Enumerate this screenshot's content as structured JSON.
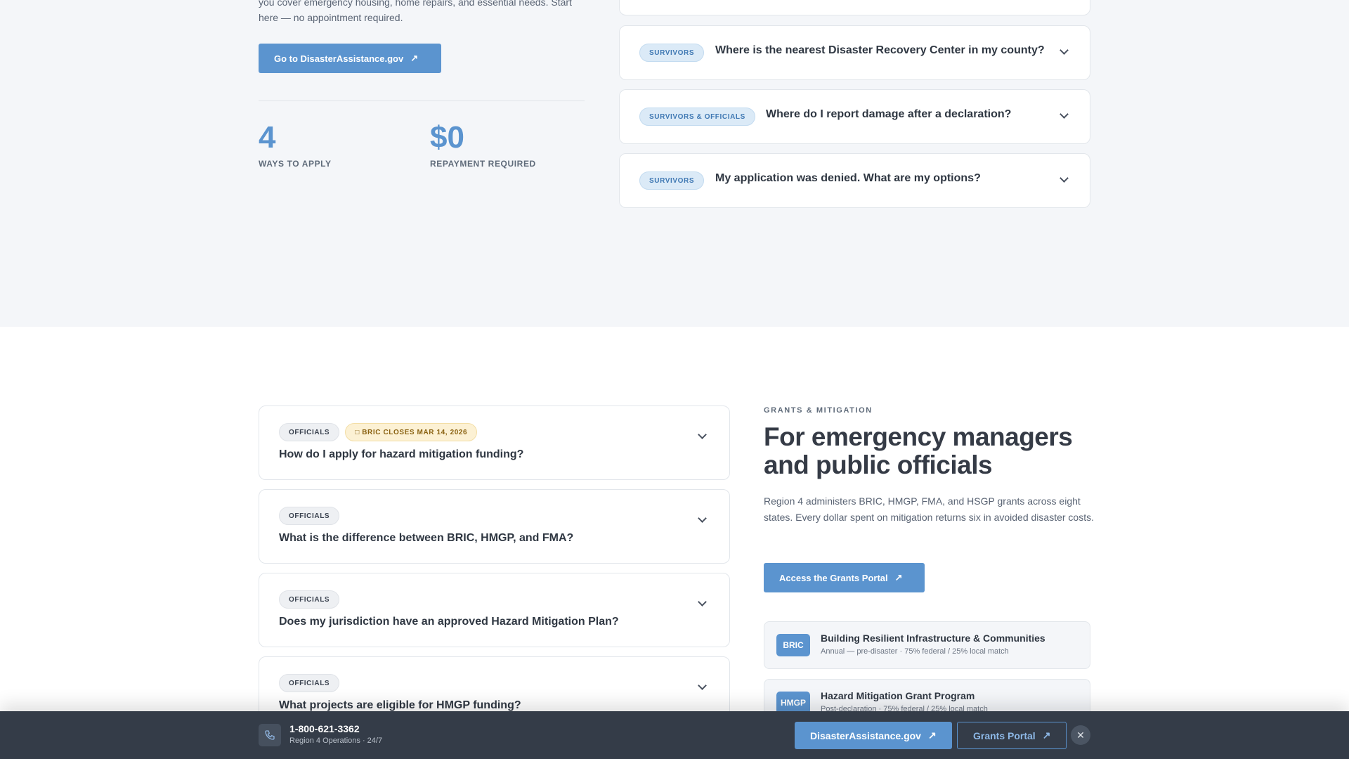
{
  "survivors": {
    "intro_tail_line1": "you cover emergency housing, home repairs, and essential needs. Start",
    "intro_tail_line2": "here — no appointment required.",
    "cta_label": "Go to DisasterAssistance.gov",
    "stats": [
      {
        "value": "4",
        "label": "WAYS TO APPLY"
      },
      {
        "value": "$0",
        "label": "REPAYMENT REQUIRED"
      }
    ],
    "faqs": [
      {
        "tag": "SURVIVORS",
        "question": "Where is the nearest Disaster Recovery Center in my county?"
      },
      {
        "tag": "SURVIVORS & OFFICIALS",
        "question": "Where do I report damage after a declaration?"
      },
      {
        "tag": "SURVIVORS",
        "question": "My application was denied. What are my options?"
      }
    ]
  },
  "officials": {
    "faqs": [
      {
        "tag": "OFFICIALS",
        "deadline": "BRIC CLOSES MAR 14, 2026",
        "question": "How do I apply for hazard mitigation funding?"
      },
      {
        "tag": "OFFICIALS",
        "question": "What is the difference between BRIC, HMGP, and FMA?"
      },
      {
        "tag": "OFFICIALS",
        "question": "Does my jurisdiction have an approved Hazard Mitigation Plan?"
      },
      {
        "tag": "OFFICIALS",
        "question": "What projects are eligible for HMGP funding?"
      }
    ],
    "eyebrow": "GRANTS & MITIGATION",
    "title_line1": "For emergency managers",
    "title_line2": "and public officials",
    "lede": "Region 4 administers BRIC, HMGP, FMA, and HSGP grants across eight states. Every dollar spent on mitigation returns six in avoided disaster costs.",
    "cta_label": "Access the Grants Portal",
    "grants": [
      {
        "code": "BRIC",
        "title": "Building Resilient Infrastructure & Communities",
        "sub": "Annual — pre-disaster · 75% federal / 25% local match"
      },
      {
        "code": "HMGP",
        "title": "Hazard Mitigation Grant Program",
        "sub": "Post-declaration · 75% federal / 25% local match"
      }
    ]
  },
  "bottom_bar": {
    "phone": "1-800-621-3362",
    "phone_sub": "Region 4 Operations · 24/7",
    "btn_primary": "DisasterAssistance.gov",
    "btn_secondary": "Grants Portal",
    "close": "✕"
  },
  "icons": {
    "external": "external-link-icon",
    "chevron": "chevron-down-icon",
    "phone": "phone-icon",
    "calendar": "calendar-icon",
    "close": "close-icon"
  },
  "colors": {
    "accent": "#5b94cf",
    "survivor_bg": "#f4f6f9",
    "bar_bg": "#343c48"
  }
}
